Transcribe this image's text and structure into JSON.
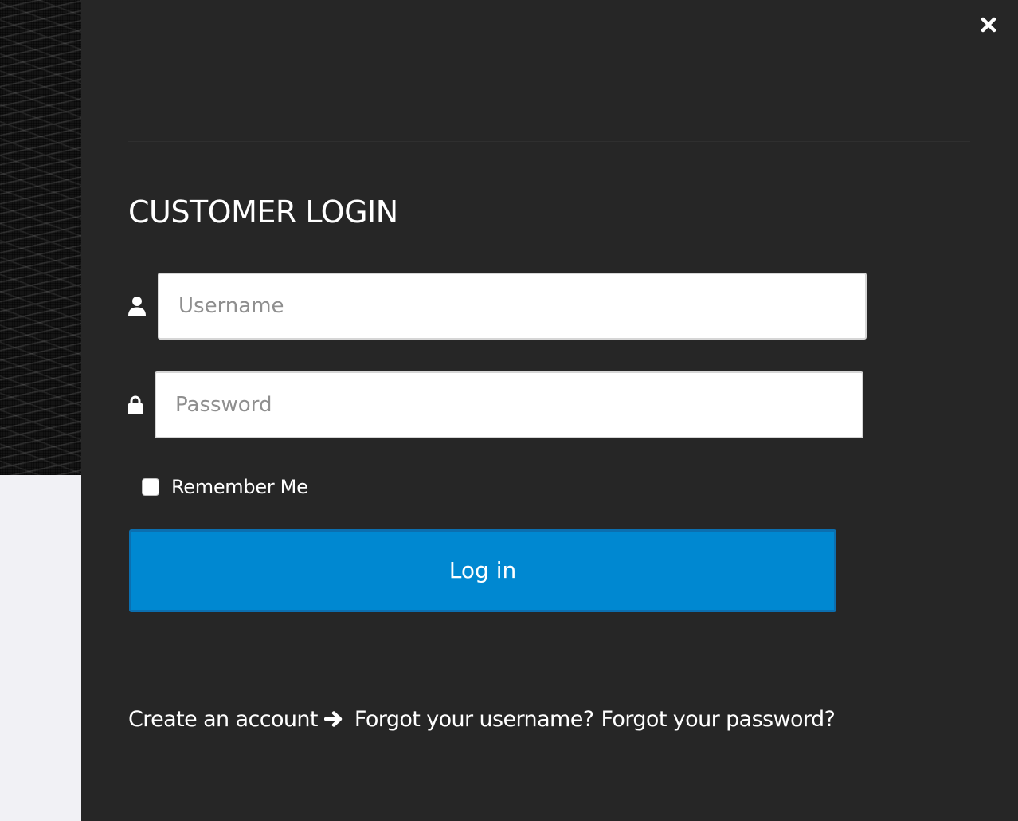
{
  "modal": {
    "title": "CUSTOMER LOGIN",
    "close_icon": "close-icon"
  },
  "form": {
    "username": {
      "placeholder": "Username",
      "value": "",
      "icon": "user-icon"
    },
    "password": {
      "placeholder": "Password",
      "value": "",
      "icon": "lock-icon"
    },
    "remember_me": {
      "label": "Remember Me",
      "checked": false
    },
    "submit_label": "Log in"
  },
  "links": {
    "create_account": "Create an account",
    "create_account_icon": "arrow-right-icon",
    "forgot_username": "Forgot your username?",
    "forgot_password": "Forgot your password?"
  },
  "colors": {
    "panel_background": "#262626",
    "button_background": "#0088d1",
    "button_border": "#0b6fb0",
    "page_background": "#f1f1f5",
    "text": "#ffffff"
  }
}
